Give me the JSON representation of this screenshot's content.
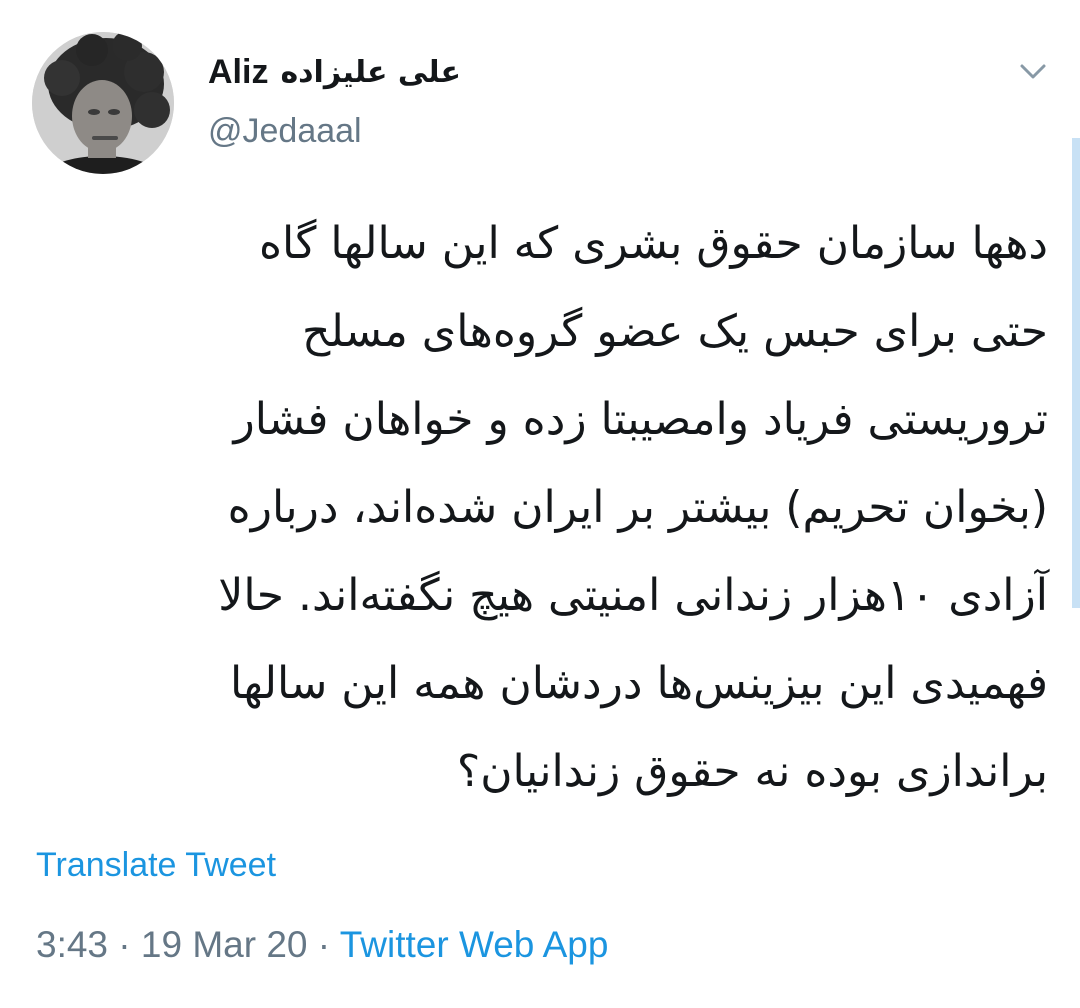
{
  "author": {
    "display_name_latin": "Aliz",
    "display_name_fa": "علی علیزاده",
    "handle": "@Jedaaal",
    "avatar_icon": "profile-photo"
  },
  "tweet": {
    "lines": [
      "دهها سازمان حقوق بشری که این سالها گاه",
      "حتی برای حبس یک عضو گروه‌های مسلح",
      "تروریستی فریاد وامصیبتا زده و خواهان فشار",
      "(بخوان تحریم) بیشتر بر ایران شده‌اند، درباره",
      "آزادی ۱۰هزار زندانی امنیتی هیچ نگفته‌اند. حالا",
      "فهمیدی این بیزینس‌ها دردشان همه این سالها",
      "براندازی بوده نه حقوق زندانیان؟"
    ]
  },
  "actions": {
    "translate_label": "Translate Tweet",
    "menu_icon": "chevron-down-icon"
  },
  "meta": {
    "time": "3:43",
    "separator": " · ",
    "date": "19 Mar 20",
    "app": "Twitter Web App"
  },
  "colors": {
    "link": "#1b95e0",
    "secondary_text": "#657786",
    "primary_text": "#14171a"
  }
}
